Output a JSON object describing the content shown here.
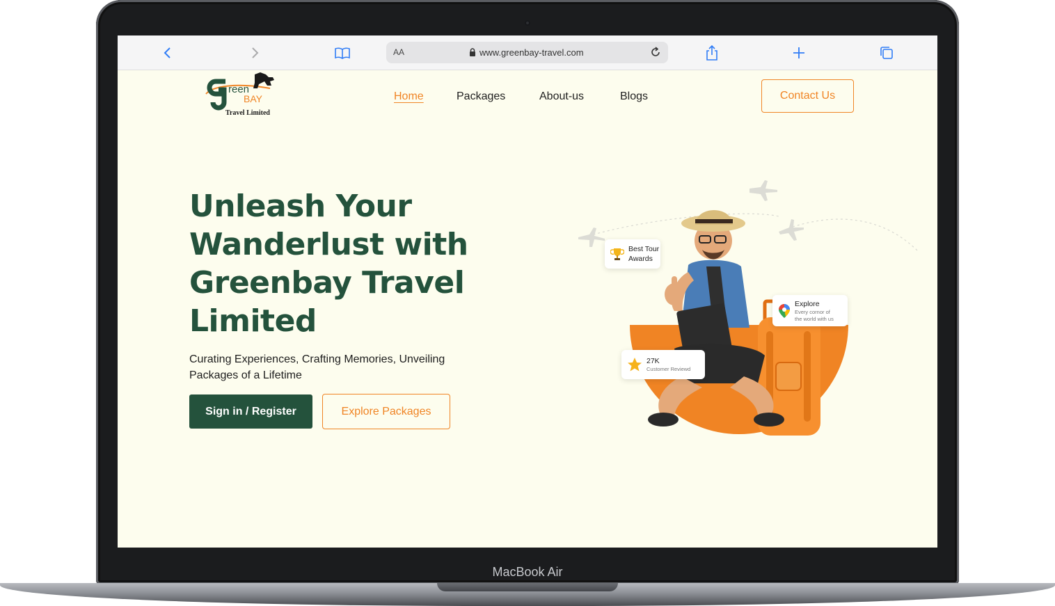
{
  "device": {
    "model_label": "MacBook Air"
  },
  "browser": {
    "text_size_label": "AA",
    "url": "www.greenbay-travel.com"
  },
  "site": {
    "logo": {
      "word1": "reen",
      "word2": "BAY",
      "tagline": "Travel Limited"
    },
    "nav": [
      {
        "label": "Home",
        "active": true
      },
      {
        "label": "Packages",
        "active": false
      },
      {
        "label": "About-us",
        "active": false
      },
      {
        "label": "Blogs",
        "active": false
      }
    ],
    "contact_label": "Contact Us"
  },
  "hero": {
    "title": "Unleash Your Wanderlust with Greenbay Travel Limited",
    "subtitle": "Curating Experiences, Crafting Memories, Unveiling Packages of a Lifetime",
    "primary_button": "Sign in / Register",
    "secondary_button": "Explore Packages"
  },
  "badges": {
    "award": {
      "line1": "Best Tour",
      "line2": "Awards"
    },
    "explore": {
      "title": "Explore",
      "line1": "Every cornor of",
      "line2": "the world with us"
    },
    "reviews": {
      "count": "27K",
      "label": "Customer Reviewd"
    }
  },
  "colors": {
    "brand_green": "#24523c",
    "accent_orange": "#f08424",
    "page_background": "#fdfdee"
  }
}
